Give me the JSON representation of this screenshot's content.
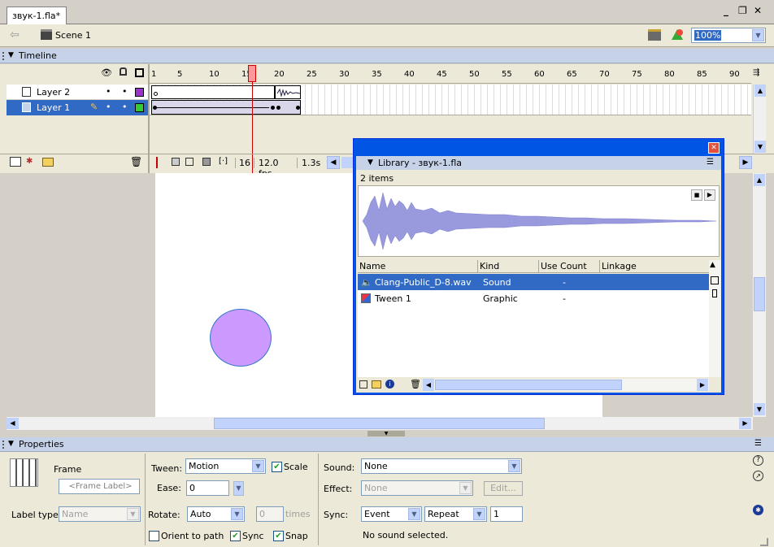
{
  "doc_tab": {
    "title": "звук-1.fla*"
  },
  "window_controls": {
    "minimize": "_",
    "restore": "❐",
    "close": "✕"
  },
  "scene_bar": {
    "scene_label": "Scene 1",
    "zoom": "100%"
  },
  "timeline": {
    "title": "Timeline",
    "ticks": [
      "1",
      "5",
      "10",
      "15",
      "20",
      "25",
      "30",
      "35",
      "40",
      "45",
      "50",
      "55",
      "60",
      "65",
      "70",
      "75",
      "80",
      "85",
      "90"
    ],
    "layers": [
      {
        "name": "Layer 2",
        "selected": false,
        "color": "#9933cc"
      },
      {
        "name": "Layer 1",
        "selected": true,
        "color": "#33cc33"
      }
    ],
    "current_frame": "16",
    "fps": "12.0 fps",
    "elapsed": "1.3s"
  },
  "library": {
    "title": "Library - звук-1.fla",
    "items_count": "2 items",
    "columns": [
      "Name",
      "Kind",
      "Use Count",
      "Linkage"
    ],
    "items": [
      {
        "name": "Clang-Public_D-8.wav",
        "kind": "Sound",
        "use_count": "-",
        "icon": "sound-icon",
        "selected": true
      },
      {
        "name": "Tween 1",
        "kind": "Graphic",
        "use_count": "-",
        "icon": "graphic-icon",
        "selected": false
      }
    ]
  },
  "stage": {
    "circle_color": "#cc99ff",
    "circle_stroke": "#3377cc"
  },
  "properties": {
    "title": "Properties",
    "frame_label": "Frame",
    "frame_label_placeholder": "<Frame Label>",
    "label_type_label": "Label type:",
    "label_type_value": "Name",
    "tween_label": "Tween:",
    "tween_value": "Motion",
    "scale_label": "Scale",
    "ease_label": "Ease:",
    "ease_value": "0",
    "rotate_label": "Rotate:",
    "rotate_value": "Auto",
    "rotate_times_value": "0",
    "times_label": "times",
    "orient_label": "Orient to path",
    "sync_check_label": "Sync",
    "snap_label": "Snap",
    "sound_label": "Sound:",
    "sound_value": "None",
    "effect_label": "Effect:",
    "effect_value": "None",
    "edit_button": "Edit...",
    "sync_label": "Sync:",
    "sync_value": "Event",
    "repeat_value": "Repeat",
    "repeat_count": "1",
    "status": "No sound selected."
  }
}
